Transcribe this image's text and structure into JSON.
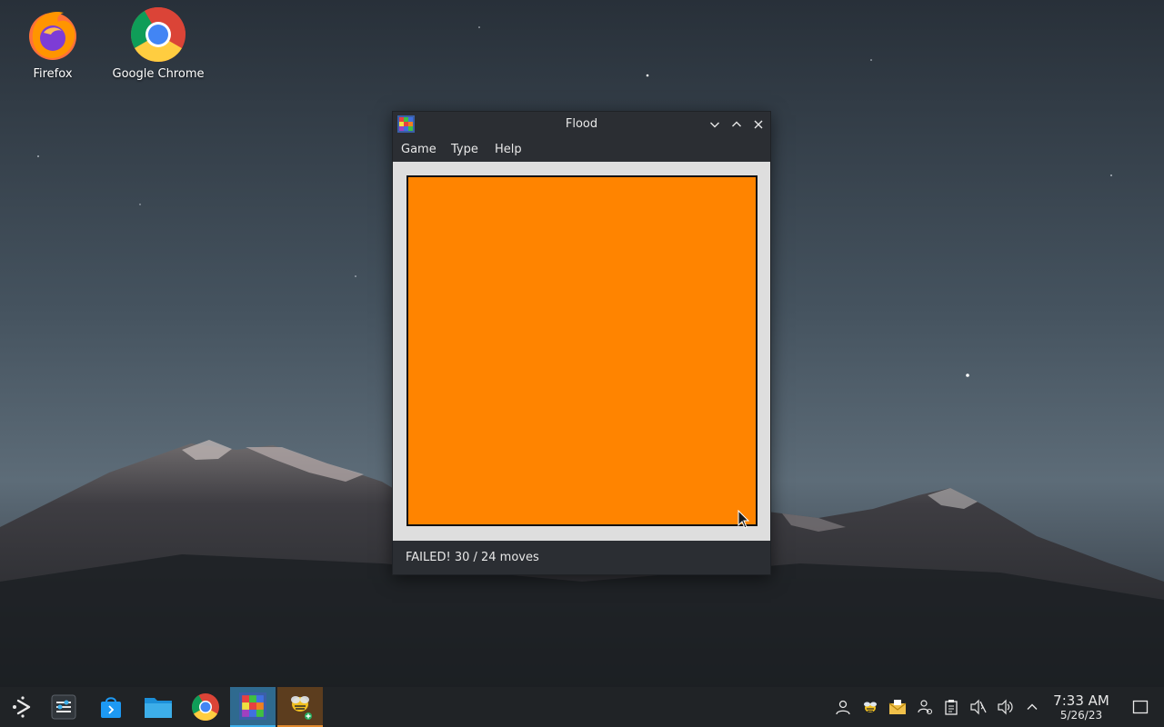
{
  "desktop": {
    "icons": [
      {
        "label": "Firefox",
        "icon": "firefox-icon"
      },
      {
        "label": "Google Chrome",
        "icon": "chrome-icon"
      }
    ]
  },
  "window": {
    "title": "Flood",
    "app_icon": "flood-app-icon",
    "controls": [
      "minimize",
      "maximize",
      "close"
    ],
    "menu": [
      {
        "label": "Game"
      },
      {
        "label": "Type"
      },
      {
        "label": "Help"
      }
    ],
    "board_color": "#ff8400",
    "status": "FAILED! 30 / 24 moves"
  },
  "taskbar": {
    "launcher_icon": "application-launcher-icon",
    "apps": [
      {
        "name": "system-settings-icon"
      },
      {
        "name": "discover-store-icon"
      },
      {
        "name": "file-manager-icon"
      },
      {
        "name": "chrome-icon"
      },
      {
        "name": "flood-app-icon",
        "active": true
      },
      {
        "name": "kbugbuster-icon",
        "active": true
      }
    ],
    "tray": [
      {
        "name": "user-icon"
      },
      {
        "name": "bug-icon"
      },
      {
        "name": "mail-icon"
      },
      {
        "name": "network-users-icon"
      },
      {
        "name": "clipboard-icon"
      },
      {
        "name": "mute-icon"
      },
      {
        "name": "volume-icon"
      },
      {
        "name": "expand-tray-icon"
      }
    ],
    "clock": {
      "time": "7:33 AM",
      "date": "5/26/23"
    },
    "show_desktop_icon": "show-desktop-icon"
  }
}
